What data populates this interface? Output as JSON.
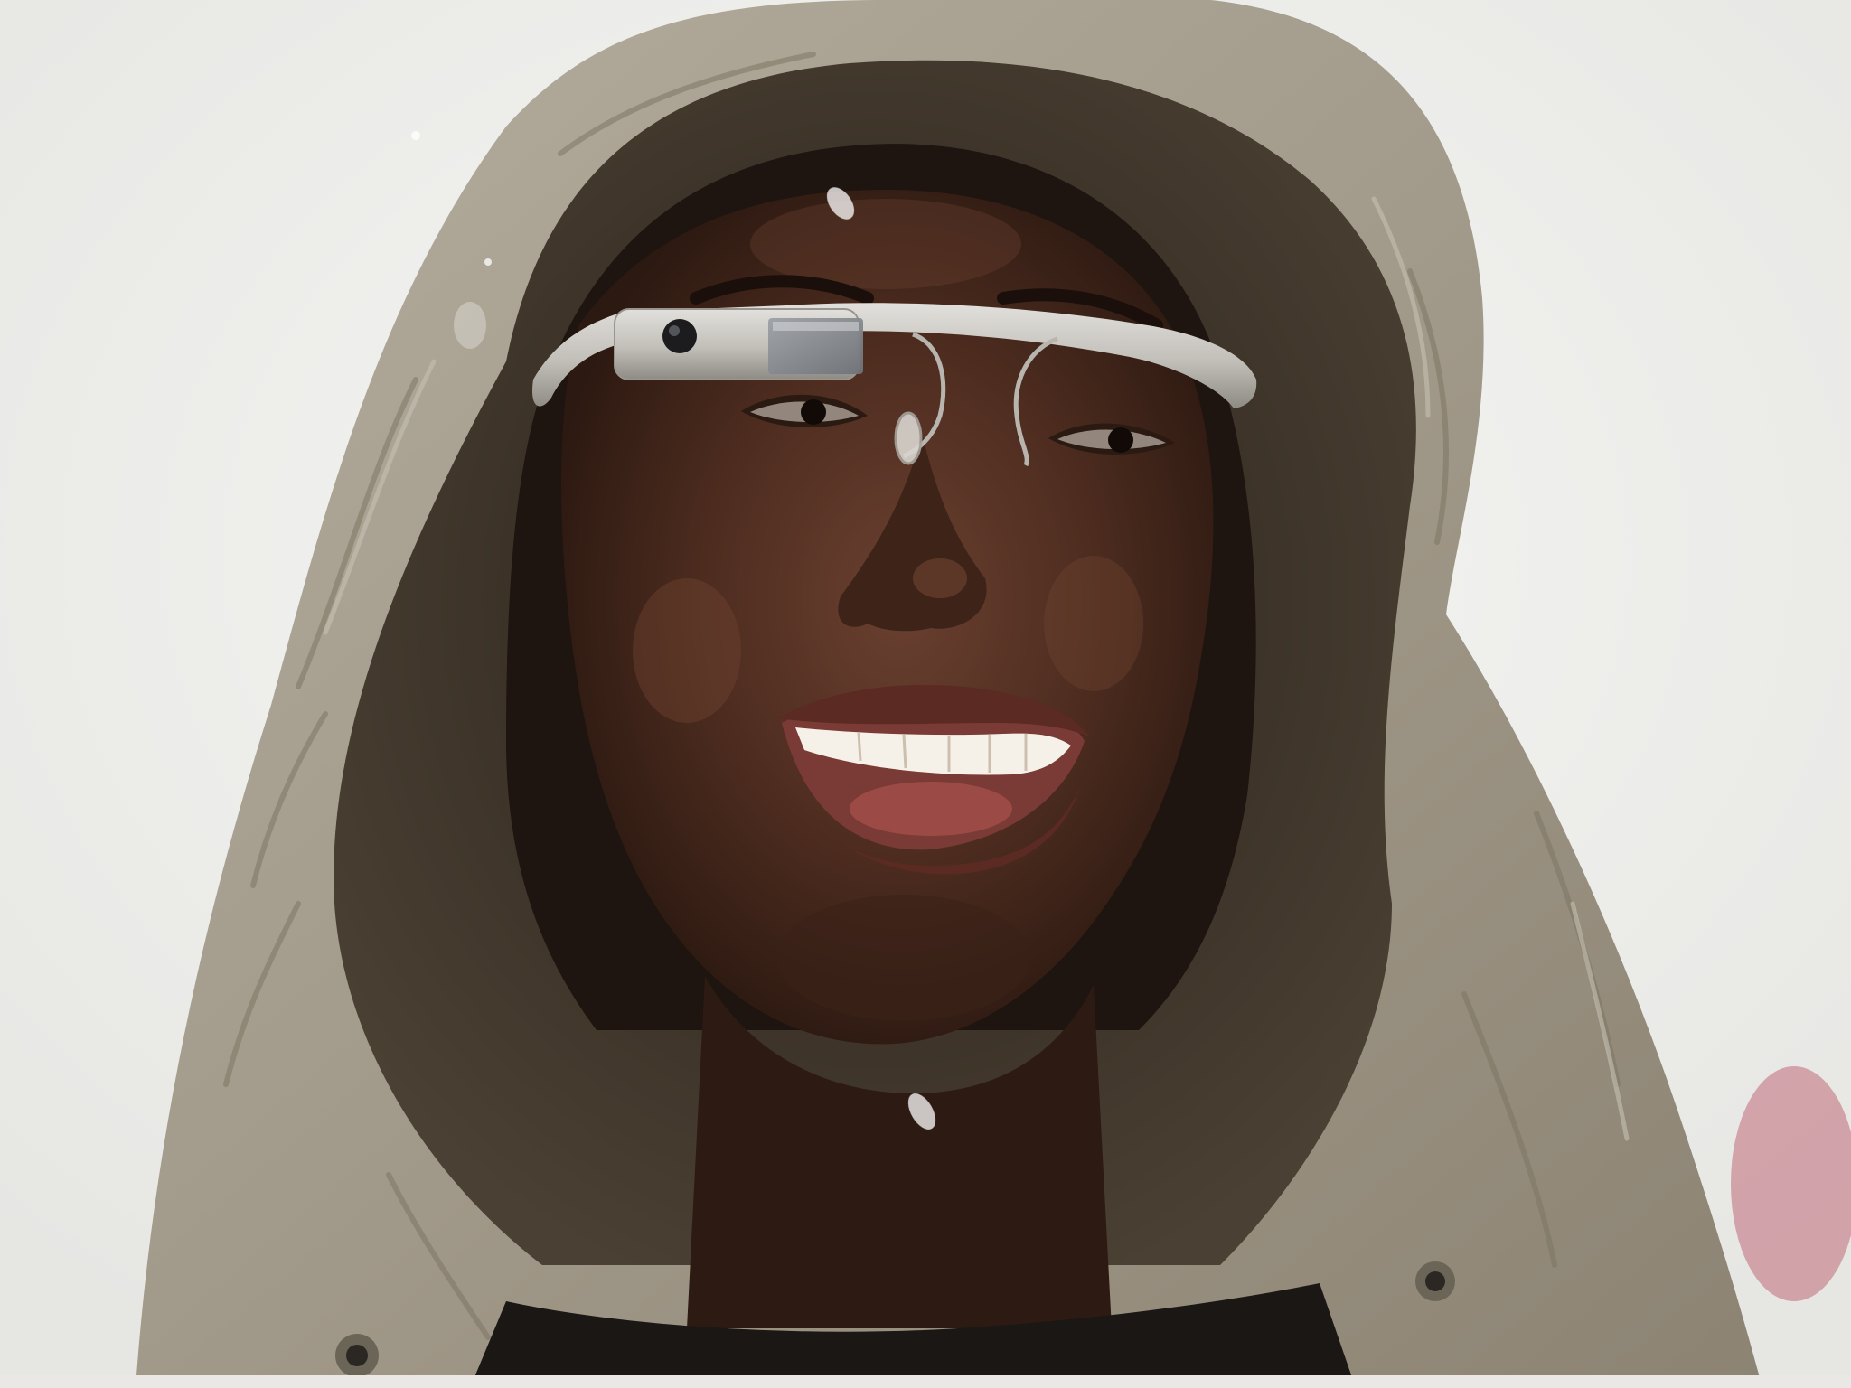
{
  "photo": {
    "subject": "person-in-hood-wearing-smart-glasses",
    "colors": {
      "sky": "#f1f1ef",
      "hood": "#a59d8d",
      "hood_shadow": "#7e7665",
      "hood_lining": "#3f362c",
      "skin": "#4a2a1d",
      "skin_highlight": "#6e4330",
      "hair": "#1e1410",
      "glasses_frame": "#c8c6c1",
      "glasses_prism": "#8d8f93",
      "teeth": "#f6f1e8",
      "mouth": "#7a3a35",
      "lips": "#5b2a22",
      "shirt": "#1a1714",
      "background_accent": "#c06a78"
    }
  }
}
